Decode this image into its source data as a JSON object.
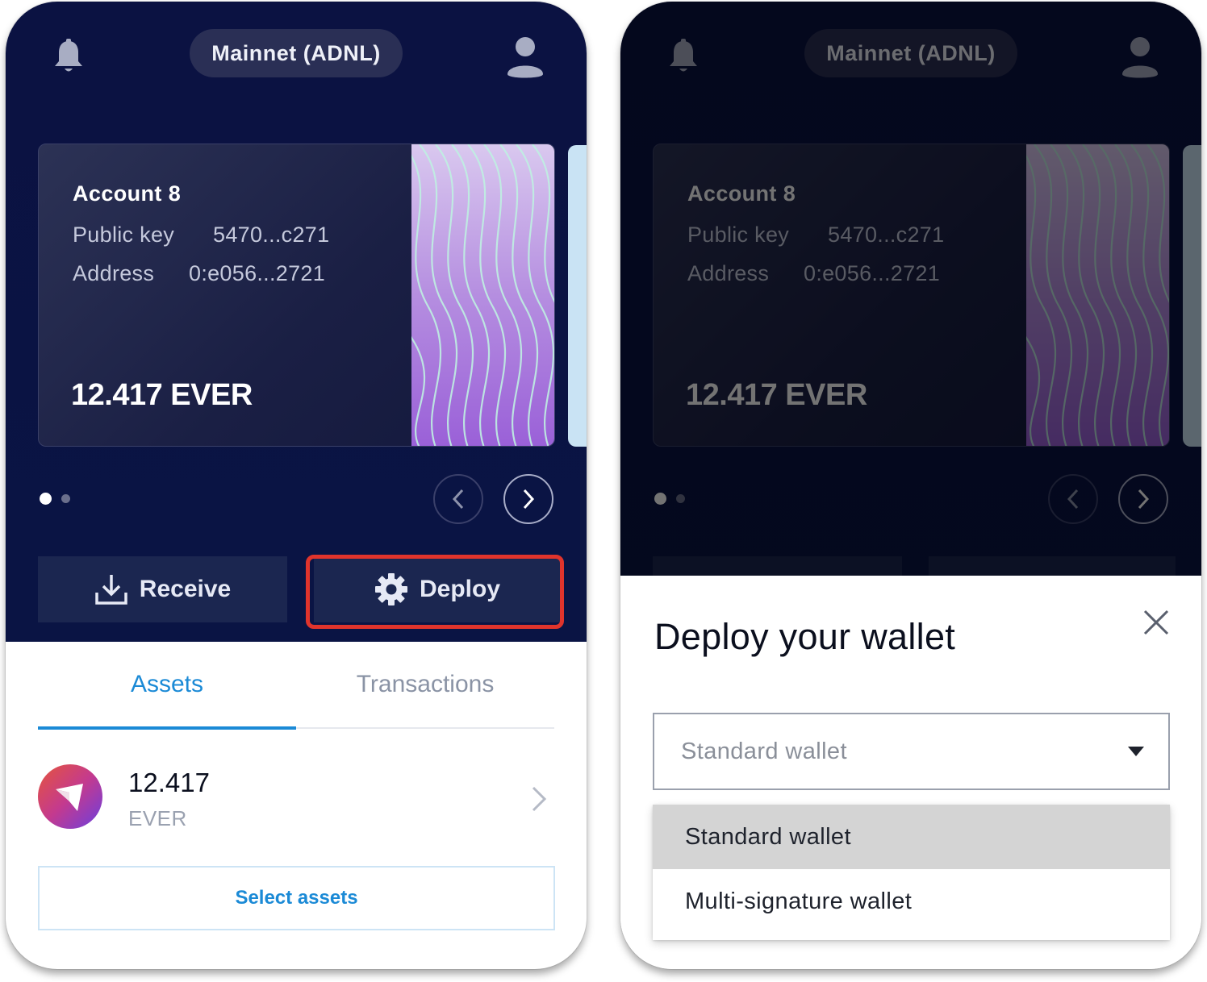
{
  "network": {
    "label": "Mainnet (ADNL)"
  },
  "account": {
    "name": "Account 8",
    "public_key_label": "Public key",
    "public_key_value": "5470...c271",
    "address_label": "Address",
    "address_value": "0:e056...2721",
    "balance": "12.417 EVER"
  },
  "carousel": {
    "page_count": 2,
    "active_index": 0
  },
  "actions": {
    "receive_label": "Receive",
    "deploy_label": "Deploy"
  },
  "tabs": {
    "assets_label": "Assets",
    "transactions_label": "Transactions",
    "active": "Assets"
  },
  "assets": [
    {
      "amount": "12.417",
      "symbol": "EVER"
    }
  ],
  "select_assets_label": "Select assets",
  "deploy_sheet": {
    "title": "Deploy your wallet",
    "selected_wallet_type": "Standard wallet",
    "options": [
      "Standard wallet",
      "Multi-signature wallet"
    ]
  },
  "colors": {
    "header_bg": "#0b1242",
    "accent": "#1b8ad6",
    "highlight_outline": "#e0342c",
    "button_bg": "#1b2650"
  }
}
